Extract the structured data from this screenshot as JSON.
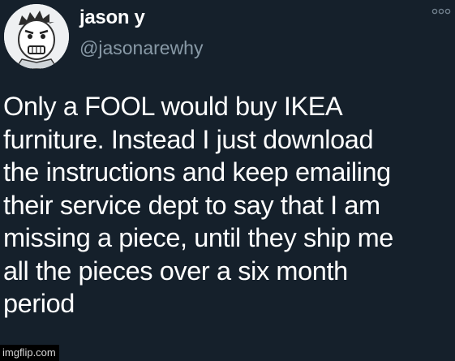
{
  "user": {
    "display_name": "jason y",
    "handle": "@jasonarewhy",
    "avatar_icon": "cartoon-face-avatar"
  },
  "more_menu_icon": "more-dots-icon",
  "tweet": {
    "text": "Only a FOOL would buy IKEA\nfurniture. Instead I just download\nthe instructions and keep emailing\ntheir service dept to say that I am\nmissing a piece, until they ship me\nall the pieces over a six month\nperiod"
  },
  "watermark": {
    "text": "imgflip.com"
  },
  "colors": {
    "background": "#15202b",
    "text_primary": "#ffffff",
    "text_secondary": "#8899a6"
  }
}
